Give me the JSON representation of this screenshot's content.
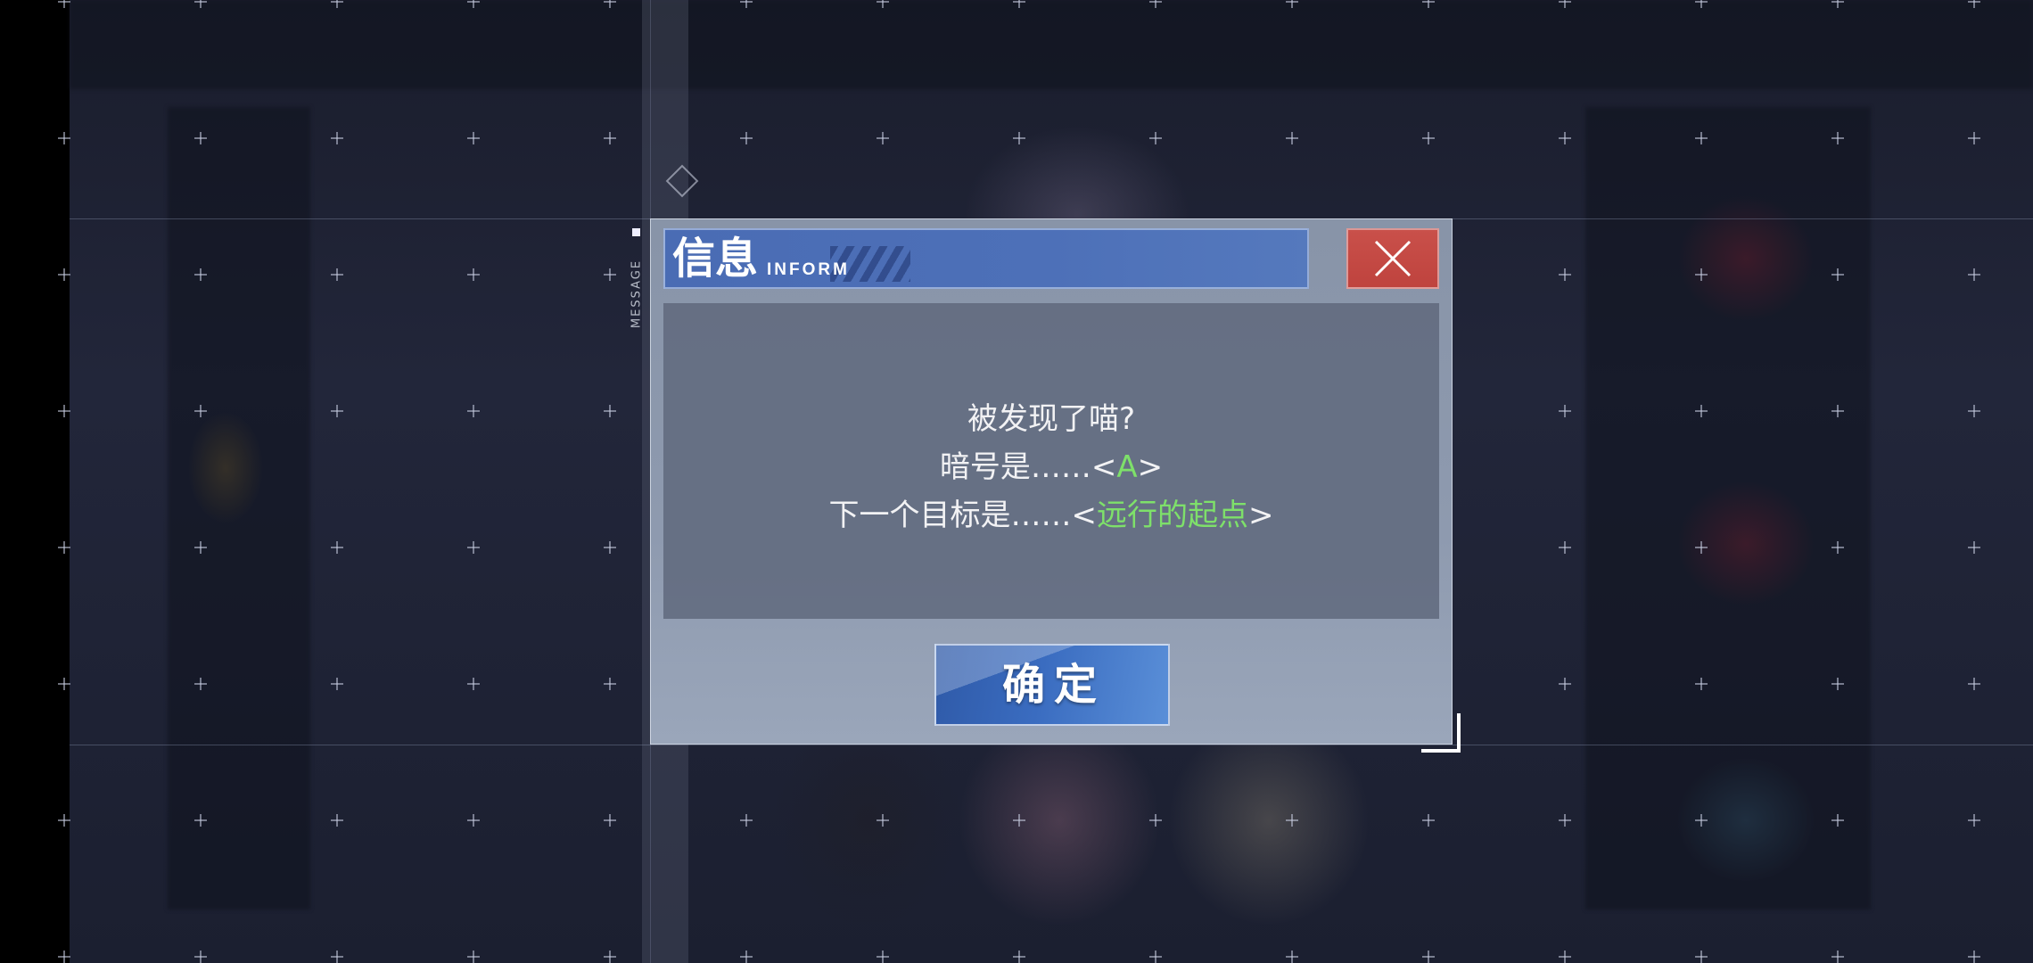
{
  "dialog": {
    "side_tag": "MESSAGE",
    "title": "信息",
    "title_en": "INFORM",
    "close_icon": "close-x-icon",
    "messages": [
      {
        "prefix": "被发现了喵?",
        "highlight": "",
        "suffix": ""
      },
      {
        "prefix": "暗号是……<",
        "highlight": "A",
        "suffix": ">"
      },
      {
        "prefix": "下一个目标是……<",
        "highlight": "远行的起点",
        "suffix": ">"
      }
    ],
    "confirm_label": "确定"
  },
  "colors": {
    "title_bar": "#4a6cb4",
    "close_button": "#c9504a",
    "highlight_text": "#7ee06a",
    "confirm_button": "#3a6cc0"
  }
}
